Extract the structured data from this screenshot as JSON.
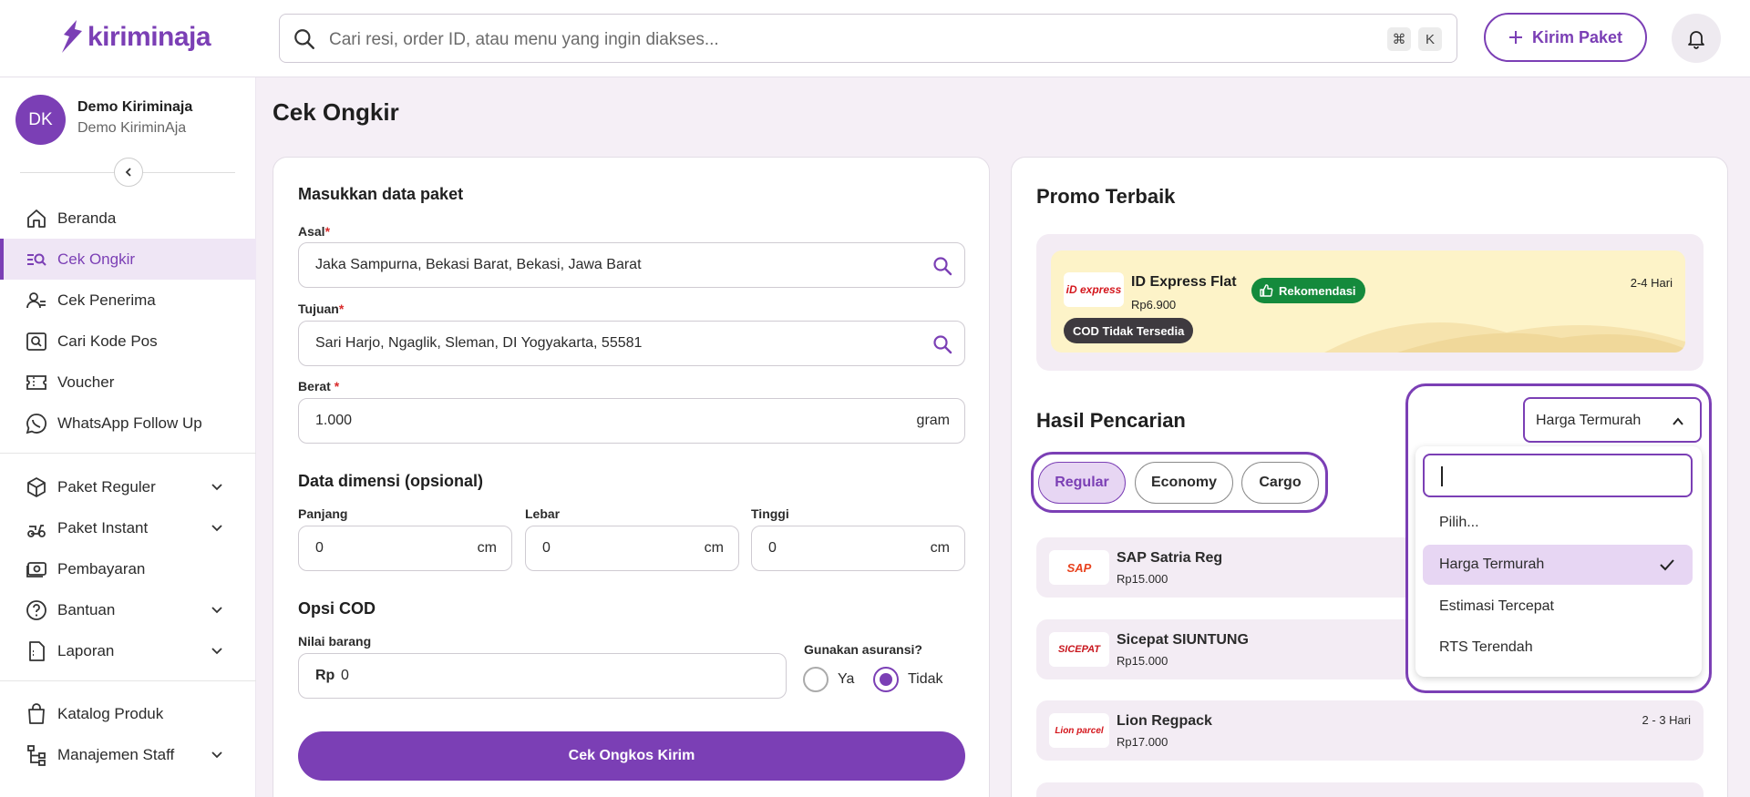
{
  "app": {
    "logo_text": "kiriminaja"
  },
  "header": {
    "search_placeholder": "Cari resi, order ID, atau menu yang ingin diakses...",
    "shortcut_cmd": "⌘",
    "shortcut_key": "K",
    "kirim_label": "Kirim Paket"
  },
  "user": {
    "initials": "DK",
    "name": "Demo Kiriminaja",
    "company": "Demo KiriminAja"
  },
  "sidebar": {
    "items": [
      {
        "label": "Beranda"
      },
      {
        "label": "Cek Ongkir"
      },
      {
        "label": "Cek Penerima"
      },
      {
        "label": "Cari Kode Pos"
      },
      {
        "label": "Voucher"
      },
      {
        "label": "WhatsApp Follow Up"
      },
      {
        "label": "Paket Reguler"
      },
      {
        "label": "Paket Instant"
      },
      {
        "label": "Pembayaran"
      },
      {
        "label": "Bantuan"
      },
      {
        "label": "Laporan"
      },
      {
        "label": "Katalog Produk"
      },
      {
        "label": "Manajemen Staff"
      }
    ]
  },
  "page": {
    "title": "Cek Ongkir"
  },
  "form": {
    "section_title": "Masukkan data paket",
    "asal_label": "Asal",
    "asal_value": "Jaka Sampurna, Bekasi Barat, Bekasi, Jawa Barat",
    "tujuan_label": "Tujuan",
    "tujuan_value": "Sari Harjo, Ngaglik, Sleman, DI Yogyakarta, 55581",
    "berat_label": "Berat",
    "berat_value": "1.000",
    "berat_unit": "gram",
    "required_mark": "*",
    "dimensi_title": "Data dimensi (opsional)",
    "panjang_label": "Panjang",
    "panjang_value": "0",
    "lebar_label": "Lebar",
    "lebar_value": "0",
    "tinggi_label": "Tinggi",
    "tinggi_value": "0",
    "dim_unit": "cm",
    "cod_title": "Opsi COD",
    "nilai_label": "Nilai barang",
    "nilai_prefix": "Rp",
    "nilai_value": "0",
    "asuransi_label": "Gunakan asuransi?",
    "asuransi_ya": "Ya",
    "asuransi_tidak": "Tidak",
    "asuransi_selected": "Tidak",
    "submit_label": "Cek Ongkos Kirim"
  },
  "promo": {
    "title": "Promo Terbaik",
    "name": "ID Express Flat",
    "badge": "Rekomendasi",
    "price": "Rp6.900",
    "eta": "2-4 Hari",
    "cod": "COD Tidak Tersedia",
    "logo": "iD express"
  },
  "results": {
    "title": "Hasil Pencarian",
    "filters": [
      "Regular",
      "Economy",
      "Cargo"
    ],
    "active_filter": "Regular",
    "rows": [
      {
        "name": "SAP Satria Reg",
        "price": "Rp15.000",
        "eta": "",
        "logo": "SAP"
      },
      {
        "name": "Sicepat SIUNTUNG",
        "price": "Rp15.000",
        "eta": "",
        "logo": "SICEPAT"
      },
      {
        "name": "Lion Regpack",
        "price": "Rp17.000",
        "eta": "2 - 3 Hari",
        "logo": "Lion parcel"
      }
    ]
  },
  "sort": {
    "selected": "Harga Termurah",
    "options": [
      "Pilih...",
      "Harga Termurah",
      "Estimasi Tercepat",
      "RTS Terendah"
    ]
  },
  "colors": {
    "primary": "#7b3fb5",
    "bg": "#f5eff6",
    "badge_green": "#148a3c",
    "promo_bg": "#fdf3c8"
  }
}
